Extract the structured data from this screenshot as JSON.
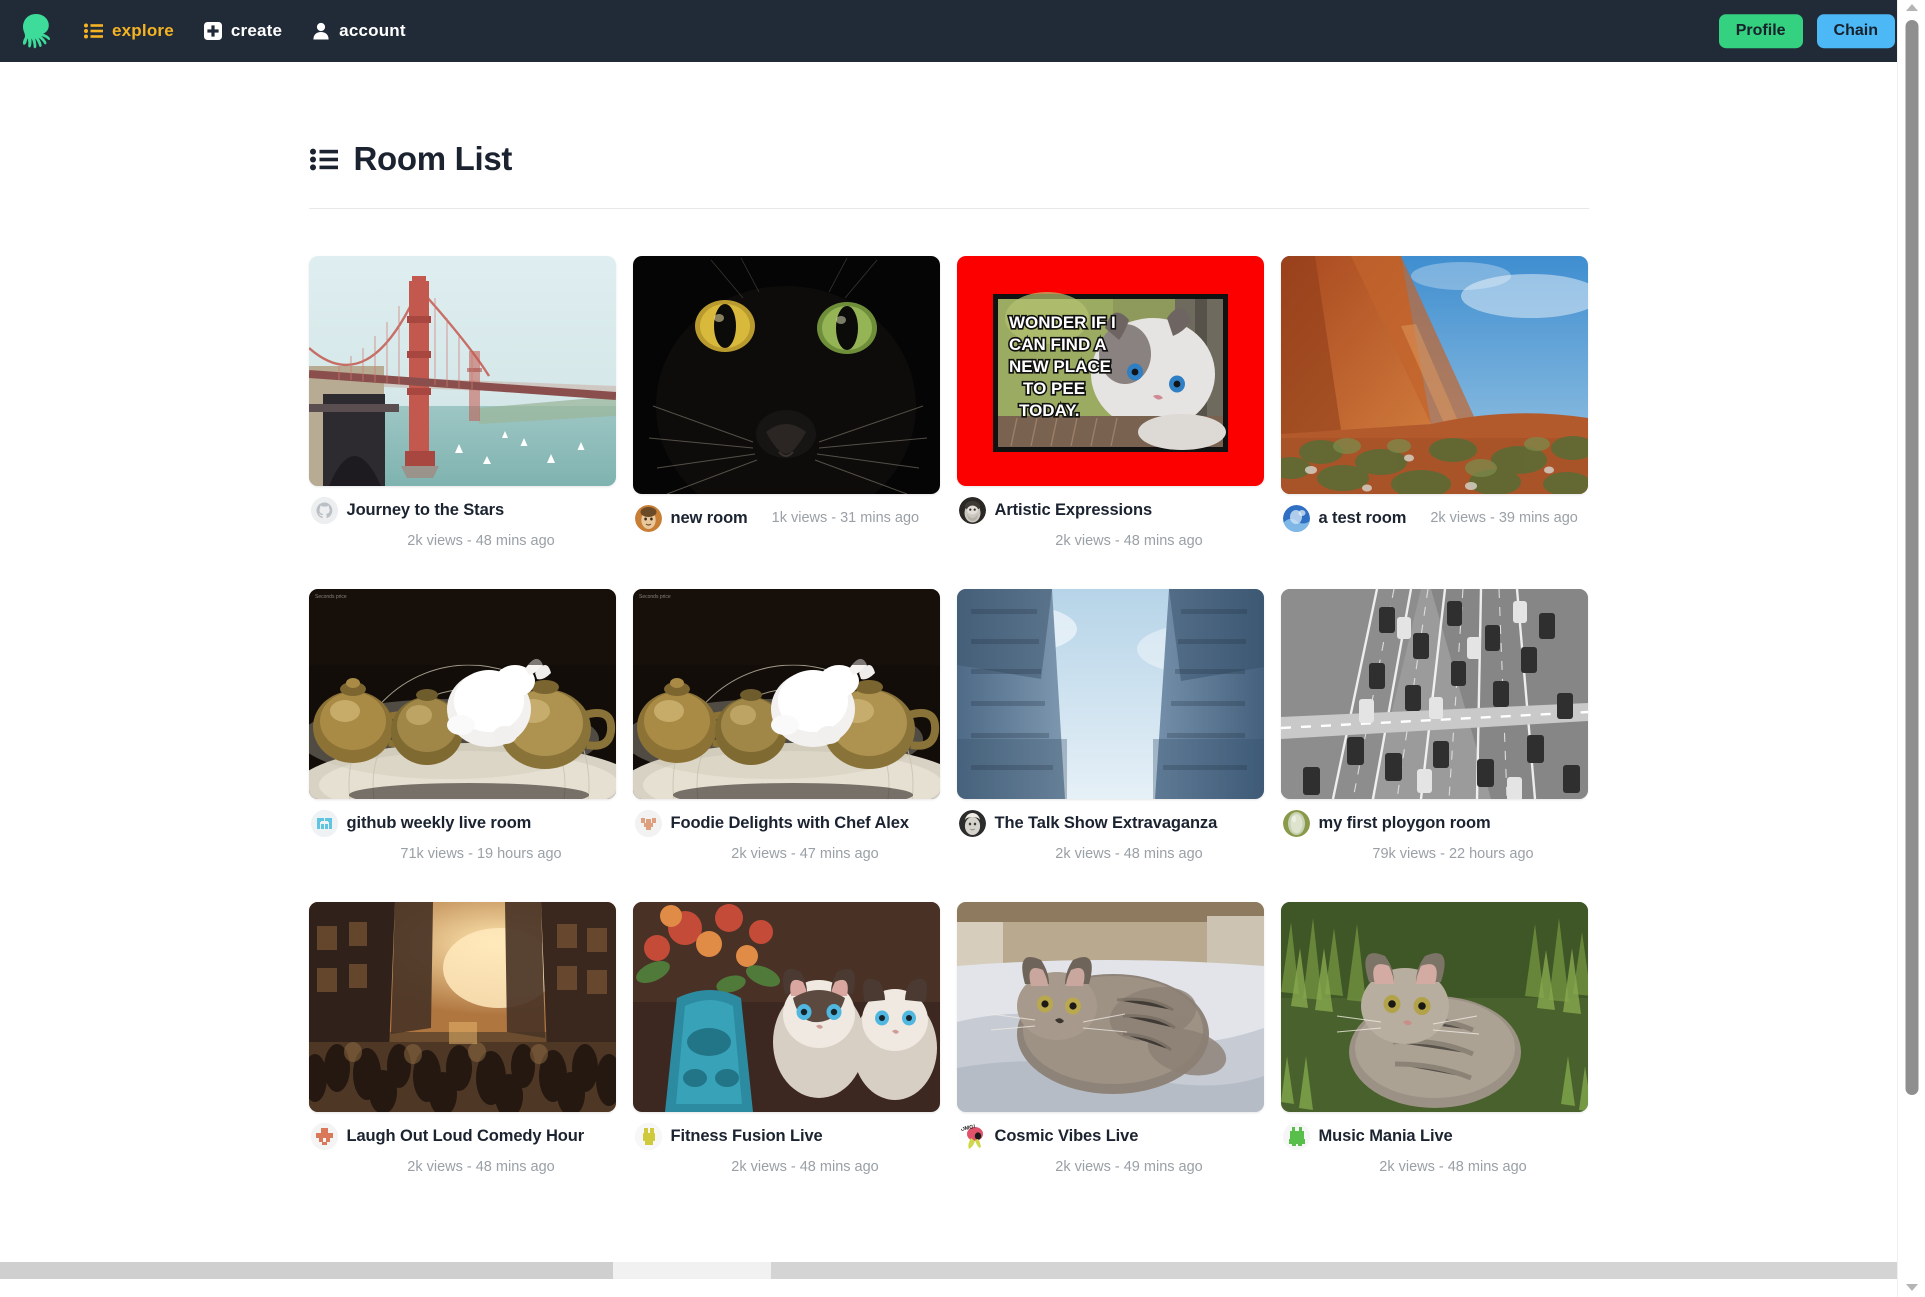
{
  "navbar": {
    "logo_icon": "octopus-logo",
    "items": [
      {
        "label": "explore",
        "icon": "list-icon",
        "active": true
      },
      {
        "label": "create",
        "icon": "plus-square-icon",
        "active": false
      },
      {
        "label": "account",
        "icon": "person-icon",
        "active": false
      }
    ],
    "profile_button": "Profile",
    "chain_button": "Chain",
    "colors": {
      "background": "#212b38",
      "active_link": "#f5b323",
      "profile": "#34d180",
      "chain": "#4cb8f5"
    }
  },
  "main": {
    "title": "Room List",
    "title_icon": "list-icon",
    "rooms": [
      {
        "title": "Journey to the Stars",
        "views": "2k views",
        "time": "48 mins ago",
        "meta": "2k views - 48 mins ago",
        "avatar": "github-octocat-avatar",
        "thumbnail": "golden-gate-bridge-photo",
        "meta_wraps": true
      },
      {
        "title": "new room",
        "views": "1k views",
        "time": "31 mins ago",
        "meta": "1k views - 31 mins ago",
        "avatar": "orange-portrait-avatar",
        "thumbnail": "black-cat-face-photo",
        "meta_wraps": false
      },
      {
        "title": "Artistic Expressions",
        "views": "2k views",
        "time": "48 mins ago",
        "meta": "2k views - 48 mins ago",
        "avatar": "bearded-man-avatar",
        "thumbnail": "cat-meme-red-background",
        "thumbnail_caption": "WONDER IF I CAN FIND A NEW PLACE TO PEE TODAY.",
        "meta_wraps": true
      },
      {
        "title": "a test room",
        "views": "2k views",
        "time": "39 mins ago",
        "meta": "2k views - 39 mins ago",
        "avatar": "blue-sky-avatar",
        "thumbnail": "red-desert-dune-photo",
        "meta_wraps": false
      },
      {
        "title": "github weekly live room",
        "views": "71k views",
        "time": "19 hours ago",
        "meta": "71k views - 19 hours ago",
        "avatar": "pixel-blue-avatar",
        "thumbnail": "brass-teapots-still-life",
        "meta_wraps": true
      },
      {
        "title": "Foodie Delights with Chef Alex",
        "views": "2k views",
        "time": "47 mins ago",
        "meta": "2k views - 47 mins ago",
        "avatar": "pixel-tan-avatar",
        "thumbnail": "brass-teapots-still-life",
        "meta_wraps": true
      },
      {
        "title": "The Talk Show Extravaganza",
        "views": "2k views",
        "time": "48 mins ago",
        "meta": "2k views - 48 mins ago",
        "avatar": "grayscale-portrait-avatar",
        "thumbnail": "buildings-sky-cross-photo",
        "meta_wraps": true
      },
      {
        "title": "my first ploygon room",
        "views": "79k views",
        "time": "22 hours ago",
        "meta": "79k views - 22 hours ago",
        "avatar": "green-orb-avatar",
        "thumbnail": "highway-aerial-bw-photo",
        "meta_wraps": true
      },
      {
        "title": "Laugh Out Loud Comedy Hour",
        "views": "2k views",
        "time": "48 mins ago",
        "meta": "2k views - 48 mins ago",
        "avatar": "pixel-salmon-avatar",
        "thumbnail": "busy-city-street-sunset",
        "meta_wraps": true
      },
      {
        "title": "Fitness Fusion Live",
        "views": "2k views",
        "time": "48 mins ago",
        "meta": "2k views - 48 mins ago",
        "avatar": "pixel-yellow-avatar",
        "thumbnail": "two-siamese-kittens-vase",
        "meta_wraps": true
      },
      {
        "title": "Cosmic Vibes Live",
        "views": "2k views",
        "time": "49 mins ago",
        "meta": "2k views - 49 mins ago",
        "avatar": "cartoon-sticker-avatar",
        "thumbnail": "tabby-cat-on-bed-photo",
        "meta_wraps": true
      },
      {
        "title": "Music Mania Live",
        "views": "2k views",
        "time": "48 mins ago",
        "meta": "2k views - 48 mins ago",
        "avatar": "pixel-green-avatar",
        "thumbnail": "kitten-in-grass-photo",
        "meta_wraps": true
      }
    ]
  },
  "scrollbars": {
    "vertical_position": "top",
    "horizontal_position": "left"
  }
}
